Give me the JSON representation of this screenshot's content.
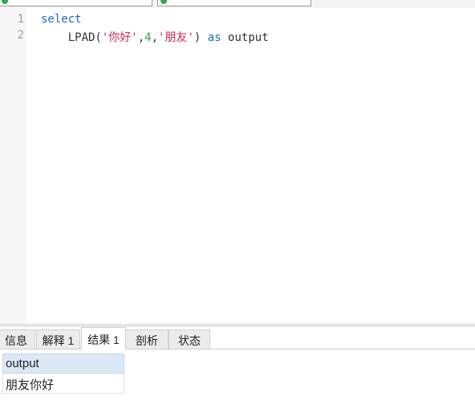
{
  "toolbar": {
    "connection_1": "",
    "connection_2": "",
    "button_1": "",
    "button_2": "",
    "button_3": ""
  },
  "editor": {
    "line_numbers": [
      "1",
      "2"
    ],
    "line1": {
      "keyword": "select"
    },
    "line2": {
      "indent": "    ",
      "func": "LPAD(",
      "str1": "'你好'",
      "comma1": ",",
      "num": "4",
      "comma2": ",",
      "str2": "'朋友'",
      "close": ") ",
      "as": "as",
      "alias": " output"
    }
  },
  "tabs": [
    {
      "label": "信息",
      "active": false
    },
    {
      "label": "解释 1",
      "active": false
    },
    {
      "label": "结果 1",
      "active": true
    },
    {
      "label": "剖析",
      "active": false
    },
    {
      "label": "状态",
      "active": false
    }
  ],
  "result": {
    "columns": [
      "output"
    ],
    "rows": [
      [
        "朋友你好"
      ]
    ]
  },
  "colors": {
    "keyword": "#1a67c8",
    "string": "#d3294f",
    "number": "#27a745",
    "header_bg": "#dbe8f5"
  }
}
